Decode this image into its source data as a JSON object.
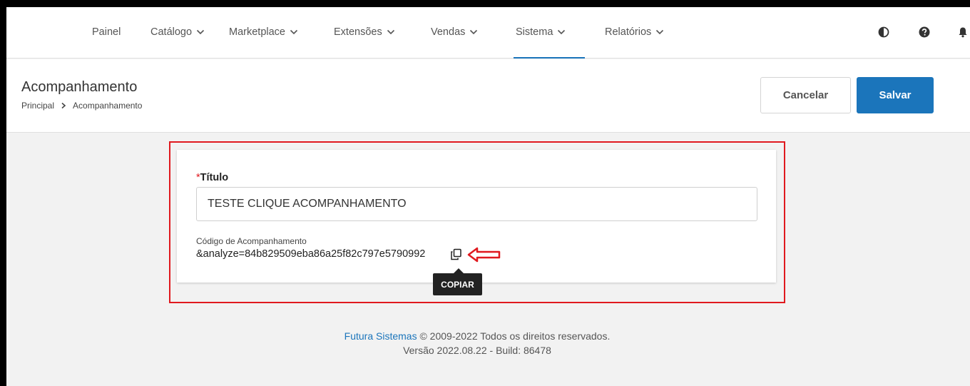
{
  "nav": {
    "items": [
      {
        "label": "Painel",
        "has_dropdown": false
      },
      {
        "label": "Catálogo",
        "has_dropdown": true
      },
      {
        "label": "Marketplace",
        "has_dropdown": true
      },
      {
        "label": "Extensões",
        "has_dropdown": true
      },
      {
        "label": "Vendas",
        "has_dropdown": true
      },
      {
        "label": "Sistema",
        "has_dropdown": true,
        "active": true
      },
      {
        "label": "Relatórios",
        "has_dropdown": true
      }
    ],
    "icons": [
      "contrast-icon",
      "help-icon",
      "bell-icon"
    ]
  },
  "header": {
    "title": "Acompanhamento",
    "breadcrumb": [
      "Principal",
      "Acompanhamento"
    ],
    "cancel_label": "Cancelar",
    "save_label": "Salvar"
  },
  "form": {
    "title_required_mark": "*",
    "title_label": "Título",
    "title_value": "TESTE CLIQUE ACOMPANHAMENTO",
    "code_label": "Código de Acompanhamento",
    "code_value": "&analyze=84b829509eba86a25f82c797e5790992",
    "copy_tooltip": "COPIAR"
  },
  "footer": {
    "company_link": "Futura Sistemas",
    "copyright": "© 2009-2022 Todos os direitos reservados.",
    "version": "Versão 2022.08.22 - Build: 86478"
  },
  "colors": {
    "accent": "#1b75bb",
    "highlight": "#e0191f",
    "tooltip_bg": "#222222"
  }
}
